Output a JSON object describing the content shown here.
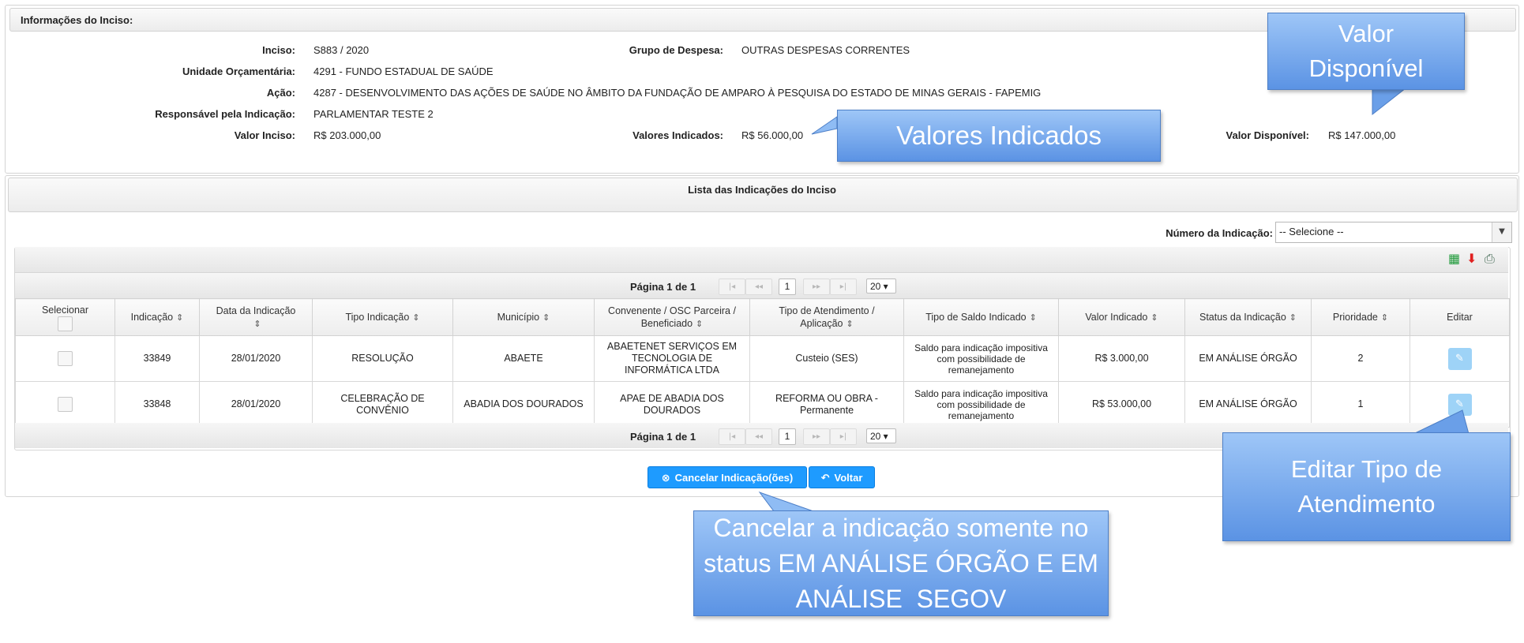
{
  "info": {
    "header": "Informações do Inciso:",
    "fields": {
      "inciso": {
        "label": "Inciso:",
        "value": "S883 / 2020"
      },
      "grupo": {
        "label": "Grupo de Despesa:",
        "value": "OUTRAS DESPESAS CORRENTES"
      },
      "unidade": {
        "label": "Unidade Orçamentária:",
        "value": "4291 - FUNDO ESTADUAL DE SAÚDE"
      },
      "acao": {
        "label": "Ação:",
        "value": "4287 - DESENVOLVIMENTO DAS AÇÕES DE SAÚDE NO ÂMBITO DA FUNDAÇÃO DE AMPARO À PESQUISA DO ESTADO DE MINAS GERAIS - FAPEMIG"
      },
      "responsavel": {
        "label": "Responsável pela Indicação:",
        "value": "PARLAMENTAR TESTE 2"
      },
      "valor_inciso": {
        "label": "Valor Inciso:",
        "value": "R$ 203.000,00"
      },
      "valores_indicados": {
        "label": "Valores Indicados:",
        "value": "R$ 56.000,00"
      },
      "valor_disponivel": {
        "label": "Valor Disponível:",
        "value": "R$ 147.000,00"
      }
    }
  },
  "list": {
    "header": "Lista das Indicações do Inciso",
    "filter_label": "Número da Indicação:",
    "filter_value": "-- Selecione --"
  },
  "pager": {
    "text": "Página 1 de 1",
    "current": "1",
    "page_size": "20 ▾",
    "first": "|◂",
    "prev": "◂◂",
    "next": "▸▸",
    "last": "▸|"
  },
  "toolbar_icons": [
    "excel-icon",
    "pdf-icon",
    "print-icon"
  ],
  "table": {
    "columns": [
      "Selecionar",
      "Indicação",
      "Data da Indicação",
      "Tipo Indicação",
      "Município",
      "Convenente / OSC Parceira / Beneficiado",
      "Tipo de Atendimento / Aplicação",
      "Tipo de Saldo Indicado",
      "Valor Indicado",
      "Status da Indicação",
      "Prioridade",
      "Editar"
    ],
    "sort_glyph": "⇕",
    "rows": [
      {
        "indicacao": "33849",
        "data": "28/01/2020",
        "tipo": "RESOLUÇÃO",
        "municipio": "ABAETE",
        "convenente": "ABAETENET SERVIÇOS EM TECNOLOGIA DE INFORMÁTICA LTDA",
        "atendimento": "Custeio (SES)",
        "saldo": "Saldo para indicação impositiva com possibilidade de remanejamento",
        "valor": "R$ 3.000,00",
        "status": "EM ANÁLISE ÓRGÃO",
        "prioridade": "2"
      },
      {
        "indicacao": "33848",
        "data": "28/01/2020",
        "tipo": "CELEBRAÇÃO DE CONVÊNIO",
        "municipio": "ABADIA DOS DOURADOS",
        "convenente": "APAE DE ABADIA DOS DOURADOS",
        "atendimento": "REFORMA OU OBRA - Permanente",
        "saldo": "Saldo para indicação impositiva com possibilidade de remanejamento",
        "valor": "R$ 53.000,00",
        "status": "EM ANÁLISE ÓRGÃO",
        "prioridade": "1"
      }
    ],
    "edit_glyph": "✎"
  },
  "buttons": {
    "cancel": "Cancelar Indicação(ões)",
    "cancel_icon": "⊗",
    "back": "Voltar",
    "back_icon": "↶"
  },
  "callouts": {
    "valor_disponivel": "Valor Disponível",
    "valores_indicados": "Valores Indicados",
    "editar": "Editar Tipo de Atendimento",
    "cancelar": "Cancelar a indicação somente no status EM ANÁLISE ÓRGÃO E EM ANÁLISE  SEGOV"
  },
  "colors": {
    "button": "#1e9bff",
    "callout": "#6a9fe8",
    "edit_button": "#9ed3f7"
  }
}
